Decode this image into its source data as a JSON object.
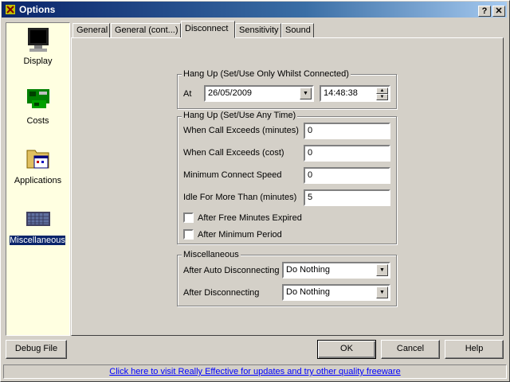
{
  "window": {
    "title": "Options",
    "help_btn": "?",
    "close_btn": "✕"
  },
  "sidebar": {
    "items": [
      {
        "label": "Display",
        "icon": "monitor-icon"
      },
      {
        "label": "Costs",
        "icon": "circuit-board-icon"
      },
      {
        "label": "Applications",
        "icon": "folder-apps-icon"
      },
      {
        "label": "Miscellaneous",
        "icon": "keyboard-icon",
        "selected": true
      }
    ]
  },
  "tabs": [
    "General",
    "General (cont...)",
    "Disconnect",
    "Sensitivity",
    "Sound"
  ],
  "active_tab": "Disconnect",
  "hangup_connected": {
    "legend": "Hang Up (Set/Use Only Whilst Connected)",
    "at_label": "At",
    "date": "26/05/2009",
    "time": "14:48:38"
  },
  "hangup_anytime": {
    "legend": "Hang Up (Set/Use Any Time)",
    "fields": [
      {
        "label": "When Call Exceeds (minutes)",
        "value": "0"
      },
      {
        "label": "When Call Exceeds (cost)",
        "value": "0"
      },
      {
        "label": "Minimum Connect Speed",
        "value": "0"
      },
      {
        "label": "Idle For More Than (minutes)",
        "value": "5"
      }
    ],
    "checkboxes": [
      {
        "label": "After Free Minutes Expired",
        "checked": false
      },
      {
        "label": "After Minimum Period",
        "checked": false
      }
    ]
  },
  "misc": {
    "legend": "Miscellaneous",
    "rows": [
      {
        "label": "After Auto Disconnecting",
        "value": "Do Nothing"
      },
      {
        "label": "After Disconnecting",
        "value": "Do Nothing"
      }
    ]
  },
  "buttons": {
    "debug": "Debug File",
    "ok": "OK",
    "cancel": "Cancel",
    "help": "Help"
  },
  "status_link": "Click here to visit Really Effective for updates and try other quality freeware"
}
